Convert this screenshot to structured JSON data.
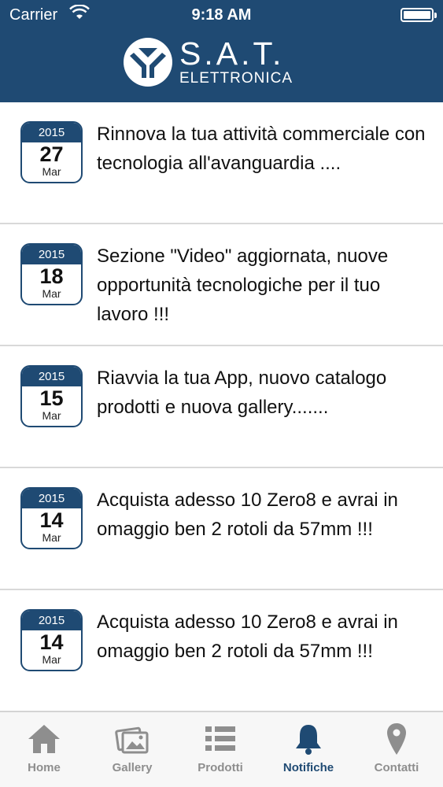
{
  "status_bar": {
    "carrier": "Carrier",
    "time": "9:18 AM"
  },
  "header": {
    "brand_title": "S.A.T.",
    "brand_subtitle": "ELETTRONICA"
  },
  "colors": {
    "primary": "#1f4a73",
    "tab_inactive": "#8e8e8e",
    "divider": "#d9d9d9"
  },
  "notifications": [
    {
      "year": "2015",
      "day": "27",
      "month": "Mar",
      "text": "Rinnova la tua attività commerciale con tecnologia all'avanguardia ...."
    },
    {
      "year": "2015",
      "day": "18",
      "month": "Mar",
      "text": "Sezione \"Video\" aggiornata, nuove opportunità tecnologiche per il tuo lavoro !!!"
    },
    {
      "year": "2015",
      "day": "15",
      "month": "Mar",
      "text": "Riavvia la tua App, nuovo catalogo prodotti e nuova gallery......."
    },
    {
      "year": "2015",
      "day": "14",
      "month": "Mar",
      "text": "Acquista adesso 10 Zero8 e avrai in omaggio ben 2 rotoli da 57mm !!!"
    },
    {
      "year": "2015",
      "day": "14",
      "month": "Mar",
      "text": "Acquista adesso 10 Zero8 e avrai in omaggio ben 2 rotoli da 57mm !!!"
    }
  ],
  "tabs": [
    {
      "label": "Home",
      "icon": "home-icon",
      "active": false
    },
    {
      "label": "Gallery",
      "icon": "gallery-icon",
      "active": false
    },
    {
      "label": "Prodotti",
      "icon": "list-icon",
      "active": false
    },
    {
      "label": "Notifiche",
      "icon": "bell-icon",
      "active": true
    },
    {
      "label": "Contatti",
      "icon": "location-pin-icon",
      "active": false
    }
  ]
}
